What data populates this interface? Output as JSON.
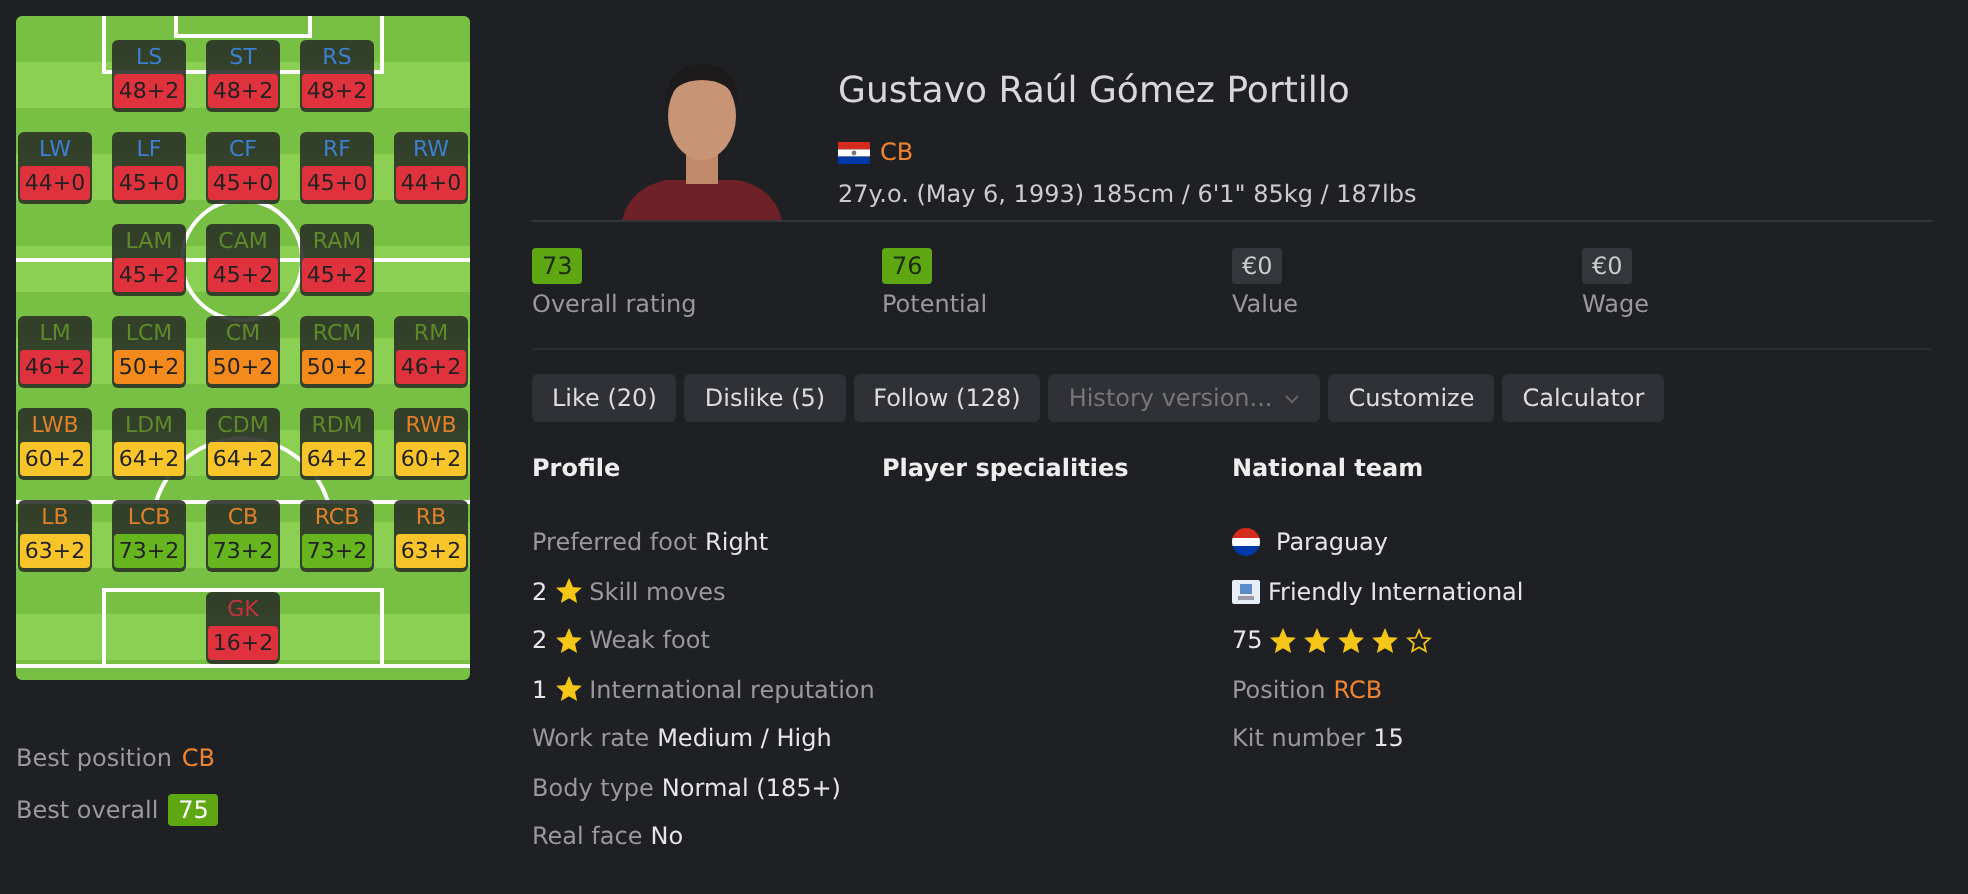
{
  "pitch": {
    "rows": [
      [
        "",
        {
          "kind": "attack",
          "label": "LS",
          "rating": {
            "text": "48+2",
            "color": "#e0323c"
          }
        },
        {
          "kind": "attack",
          "label": "ST",
          "rating": {
            "text": "48+2",
            "color": "#e0323c"
          }
        },
        {
          "kind": "attack",
          "label": "RS",
          "rating": {
            "text": "48+2",
            "color": "#e0323c"
          }
        },
        ""
      ],
      [
        {
          "kind": "attack",
          "label": "LW",
          "rating": {
            "text": "44+0",
            "color": "#e0323c"
          }
        },
        {
          "kind": "attack",
          "label": "LF",
          "rating": {
            "text": "45+0",
            "color": "#e0323c"
          }
        },
        {
          "kind": "attack",
          "label": "CF",
          "rating": {
            "text": "45+0",
            "color": "#e0323c"
          }
        },
        {
          "kind": "attack",
          "label": "RF",
          "rating": {
            "text": "45+0",
            "color": "#e0323c"
          }
        },
        {
          "kind": "attack",
          "label": "RW",
          "rating": {
            "text": "44+0",
            "color": "#e0323c"
          }
        }
      ],
      [
        "",
        {
          "kind": "midfield",
          "label": "LAM",
          "rating": {
            "text": "45+2",
            "color": "#e0323c"
          }
        },
        {
          "kind": "midfield",
          "label": "CAM",
          "rating": {
            "text": "45+2",
            "color": "#e0323c"
          }
        },
        {
          "kind": "midfield",
          "label": "RAM",
          "rating": {
            "text": "45+2",
            "color": "#e0323c"
          }
        },
        ""
      ],
      [
        {
          "kind": "midfield",
          "label": "LM",
          "rating": {
            "text": "46+2",
            "color": "#e0323c"
          }
        },
        {
          "kind": "midfield",
          "label": "LCM",
          "rating": {
            "text": "50+2",
            "color": "#f58a1c"
          }
        },
        {
          "kind": "midfield",
          "label": "CM",
          "rating": {
            "text": "50+2",
            "color": "#f58a1c"
          }
        },
        {
          "kind": "midfield",
          "label": "RCM",
          "rating": {
            "text": "50+2",
            "color": "#f58a1c"
          }
        },
        {
          "kind": "midfield",
          "label": "RM",
          "rating": {
            "text": "46+2",
            "color": "#e0323c"
          }
        }
      ],
      [
        {
          "kind": "defense",
          "label": "LWB",
          "rating": {
            "text": "60+2",
            "color": "#f7c52a"
          }
        },
        {
          "kind": "midfield",
          "label": "LDM",
          "rating": {
            "text": "64+2",
            "color": "#f7c52a"
          }
        },
        {
          "kind": "midfield",
          "label": "CDM",
          "rating": {
            "text": "64+2",
            "color": "#f7c52a"
          }
        },
        {
          "kind": "midfield",
          "label": "RDM",
          "rating": {
            "text": "64+2",
            "color": "#f7c52a"
          }
        },
        {
          "kind": "defense",
          "label": "RWB",
          "rating": {
            "text": "60+2",
            "color": "#f7c52a"
          }
        }
      ],
      [
        {
          "kind": "defense",
          "label": "LB",
          "rating": {
            "text": "63+2",
            "color": "#f7c52a"
          }
        },
        {
          "kind": "defense",
          "label": "LCB",
          "rating": {
            "text": "73+2",
            "color": "#66b51e"
          }
        },
        {
          "kind": "defense",
          "label": "CB",
          "rating": {
            "text": "73+2",
            "color": "#66b51e"
          }
        },
        {
          "kind": "defense",
          "label": "RCB",
          "rating": {
            "text": "73+2",
            "color": "#66b51e"
          }
        },
        {
          "kind": "defense",
          "label": "RB",
          "rating": {
            "text": "63+2",
            "color": "#f7c52a"
          }
        }
      ],
      [
        "",
        "",
        {
          "kind": "goalkeeper",
          "label": "GK",
          "rating": {
            "text": "16+2",
            "color": "#e0323c"
          }
        },
        "",
        ""
      ]
    ]
  },
  "best": {
    "position_label": "Best position",
    "position": "CB",
    "overall_label": "Best overall",
    "overall": "75"
  },
  "player": {
    "name": "Gustavo Raúl Gómez Portillo",
    "position": "CB",
    "info": "27y.o. (May 6, 1993) 185cm / 6'1\" 85kg / 187lbs"
  },
  "stats": [
    {
      "value": "73",
      "label": "Overall rating",
      "kind": "rating"
    },
    {
      "value": "76",
      "label": "Potential",
      "kind": "rating"
    },
    {
      "value": "€0",
      "label": "Value",
      "kind": "money"
    },
    {
      "value": "€0",
      "label": "Wage",
      "kind": "money"
    }
  ],
  "actions": [
    {
      "label": "Like (20)",
      "kind": "button"
    },
    {
      "label": "Dislike (5)",
      "kind": "button"
    },
    {
      "label": "Follow (128)",
      "kind": "button"
    },
    {
      "label": "History version...",
      "kind": "select"
    },
    {
      "label": "Customize",
      "kind": "button"
    },
    {
      "label": "Calculator",
      "kind": "button"
    }
  ],
  "profile": {
    "title": "Profile",
    "items": [
      {
        "kind": "pair",
        "label": "Preferred foot",
        "value": "Right"
      },
      {
        "kind": "star",
        "count": "2",
        "label": "Skill moves"
      },
      {
        "kind": "star",
        "count": "2",
        "label": "Weak foot"
      },
      {
        "kind": "star",
        "count": "1",
        "label": "International reputation"
      },
      {
        "kind": "pair",
        "label": "Work rate",
        "value": "Medium / High"
      },
      {
        "kind": "pair",
        "label": "Body type",
        "value": "Normal (185+)"
      },
      {
        "kind": "pair",
        "label": "Real face",
        "value": "No"
      }
    ]
  },
  "specialities": {
    "title": "Player specialities"
  },
  "national_team": {
    "title": "National team",
    "country": "Paraguay",
    "competition": "Friendly International",
    "rating": "75",
    "stars": 4,
    "position_label": "Position",
    "position": "RCB",
    "kit_label": "Kit number",
    "kit": "15"
  }
}
